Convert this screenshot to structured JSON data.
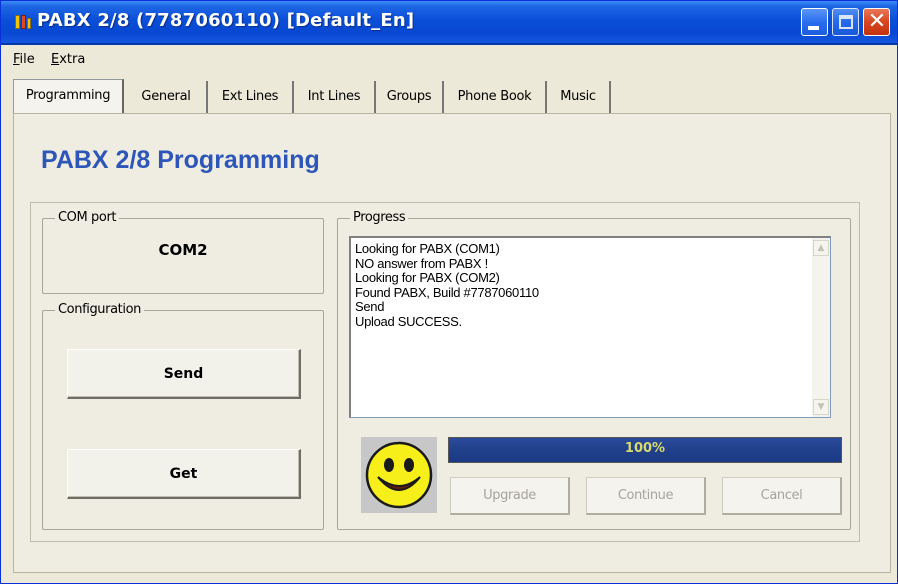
{
  "window": {
    "title": "PABX 2/8 (7787060110) [Default_En]",
    "icon": "pabx-app-icon",
    "controls": {
      "minimize": "minimize-icon",
      "maximize": "maximize-icon",
      "close": "close-icon",
      "close_glyph": "✕"
    }
  },
  "menu": {
    "file_key": "F",
    "file_rest": "ile",
    "extra_key": "E",
    "extra_rest": "xtra"
  },
  "tabs": [
    {
      "label": "Programming",
      "active": true
    },
    {
      "label": "General",
      "active": false
    },
    {
      "label": "Ext Lines",
      "active": false
    },
    {
      "label": "Int Lines",
      "active": false
    },
    {
      "label": "Groups",
      "active": false
    },
    {
      "label": "Phone Book",
      "active": false
    },
    {
      "label": "Music",
      "active": false
    }
  ],
  "main": {
    "heading": "PABX 2/8 Programming",
    "com_port": {
      "label": "COM port",
      "value": "COM2"
    },
    "configuration": {
      "label": "Configuration",
      "send_label": "Send",
      "get_label": "Get"
    },
    "progress": {
      "label": "Progress",
      "log": [
        "Looking for PABX (COM1)",
        "NO answer from PABX !",
        "Looking for PABX (COM2)",
        "Found PABX, Build #7787060110",
        "Send",
        "Upload SUCCESS."
      ],
      "percent": 100,
      "percent_text": "100%",
      "status_icon": "smiley-face-icon",
      "upgrade_label": "Upgrade",
      "continue_label": "Continue",
      "cancel_label": "Cancel"
    }
  },
  "colors": {
    "titlebar": "#0a4fd8",
    "heading": "#2d56b8",
    "progress_fill": "#21408b",
    "progress_text": "#d7db6b",
    "smiley": "#f7ef1a"
  }
}
